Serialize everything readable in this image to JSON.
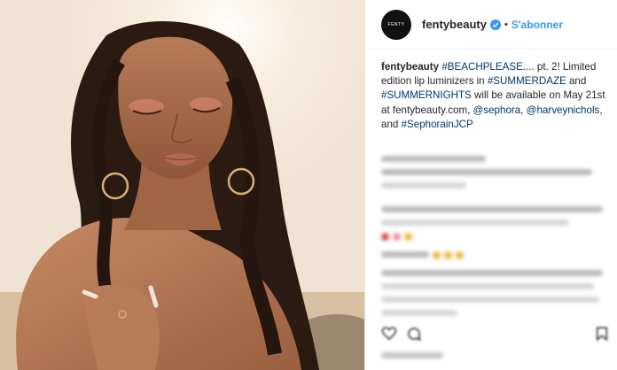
{
  "post": {
    "username": "fentybeauty",
    "follow_label": "S'abonner",
    "separator": "•",
    "caption": {
      "author": "fentybeauty",
      "t1": " ",
      "tag1": "#BEACHPLEASE",
      "t2": ".... pt. 2! Limited edition lip luminizers in ",
      "tag2": "#SUMMERDAZE",
      "t3": " and ",
      "tag3": "#SUMMERNIGHTS",
      "t4": " will be available on May 21st at fentybeauty.com, ",
      "tag4": "@sephora",
      "t5": ", ",
      "tag5": "@harveynichols",
      "t6": ", and ",
      "tag6": "#SephorainJCP"
    }
  },
  "colors": {
    "link": "#003569",
    "follow": "#3897f0",
    "verified": "#3897f0"
  },
  "icons": {
    "verified": "verified-badge-icon",
    "like": "heart-icon",
    "comment": "comment-icon",
    "save": "bookmark-icon"
  }
}
